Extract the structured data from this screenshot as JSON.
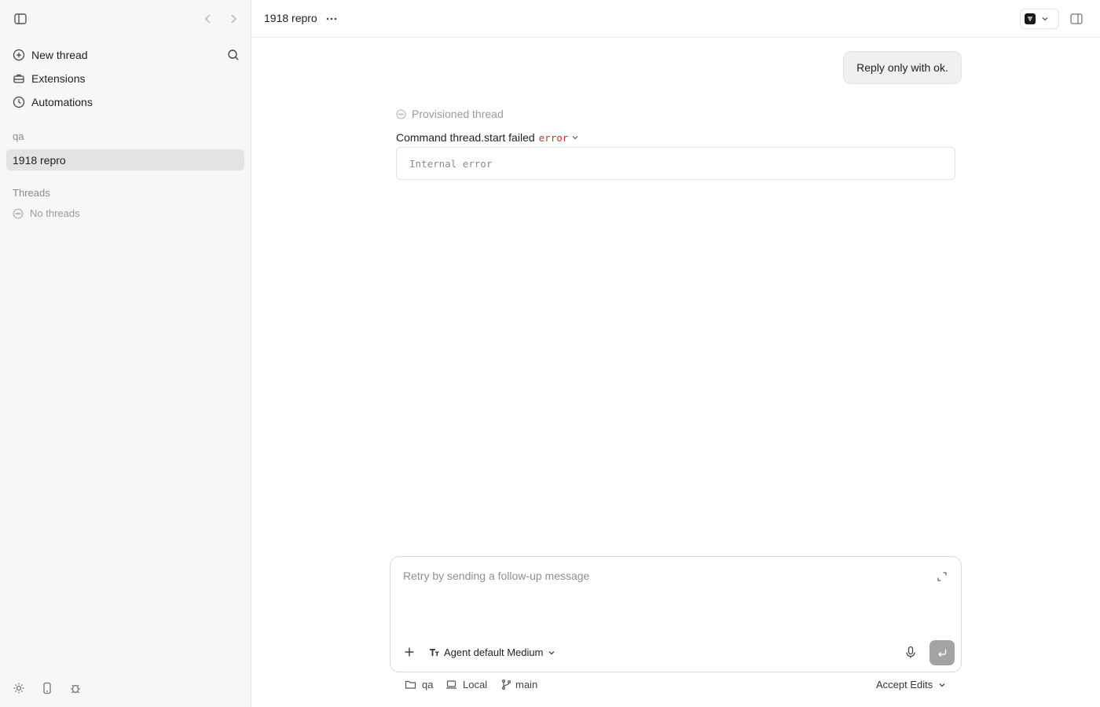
{
  "sidebar": {
    "nav": [
      {
        "label": "New thread",
        "icon": "plus-circle-icon"
      },
      {
        "label": "Extensions",
        "icon": "toolbox-icon"
      },
      {
        "label": "Automations",
        "icon": "clock-icon"
      }
    ],
    "project_label": "qa",
    "active_thread": "1918 repro",
    "threads_label": "Threads",
    "no_threads": "No threads"
  },
  "header": {
    "title": "1918 repro"
  },
  "conversation": {
    "user_message": "Reply only with ok.",
    "provisioned": "Provisioned thread",
    "command_failed": "Command thread.start failed",
    "error_tag": "error",
    "error_detail": "Internal error"
  },
  "composer": {
    "placeholder": "Retry by sending a follow-up message",
    "model": "Agent default Medium"
  },
  "footer": {
    "folder": "qa",
    "environment": "Local",
    "branch": "main",
    "mode": "Accept Edits"
  },
  "colors": {
    "sidebar_bg": "#f7f7f7",
    "active_item_bg": "#e3e3e3",
    "error_red": "#c2352b",
    "send_disabled": "#a3a3a3"
  }
}
